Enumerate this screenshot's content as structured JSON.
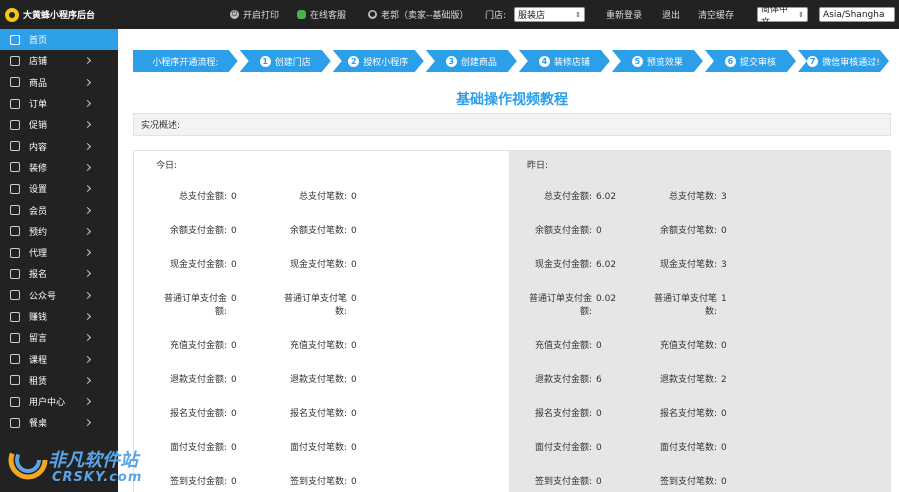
{
  "app": {
    "title": "大黄蜂小程序后台"
  },
  "topbar": {
    "print": "开启打印",
    "service": "在线客服",
    "user": "老郭（卖家--基础版）",
    "store_label": "门店:",
    "store_value": "服装店",
    "relogin": "重新登录",
    "logout": "退出",
    "clear_cache": "清空缓存",
    "language": "简体中文",
    "timezone": "Asia/Shangha"
  },
  "sidebar": {
    "items": [
      {
        "label": "首页",
        "active": true
      },
      {
        "label": "店铺"
      },
      {
        "label": "商品"
      },
      {
        "label": "订单"
      },
      {
        "label": "促销"
      },
      {
        "label": "内容"
      },
      {
        "label": "装修"
      },
      {
        "label": "设置"
      },
      {
        "label": "会员"
      },
      {
        "label": "预约"
      },
      {
        "label": "代理"
      },
      {
        "label": "报名"
      },
      {
        "label": "公众号"
      },
      {
        "label": "赚钱"
      },
      {
        "label": "留言"
      },
      {
        "label": "课程"
      },
      {
        "label": "租赁"
      },
      {
        "label": "用户中心"
      },
      {
        "label": "餐桌"
      }
    ]
  },
  "steps": {
    "intro": "小程序开通流程:",
    "items": [
      {
        "num": "1",
        "label": "创建门店"
      },
      {
        "num": "2",
        "label": "授权小程序"
      },
      {
        "num": "3",
        "label": "创建商品"
      },
      {
        "num": "4",
        "label": "装修店铺"
      },
      {
        "num": "5",
        "label": "预览效果"
      },
      {
        "num": "6",
        "label": "提交审核"
      },
      {
        "num": "7",
        "label": "微信审核通过!"
      }
    ]
  },
  "main": {
    "title": "基础操作视频教程",
    "overview": "实况概述:"
  },
  "stats": {
    "today": {
      "title": "今日:",
      "rows": [
        [
          {
            "label": "总支付金额:",
            "value": "0"
          },
          {
            "label": "总支付笔数:",
            "value": "0"
          }
        ],
        [
          {
            "label": "余额支付金额:",
            "value": "0"
          },
          {
            "label": "余额支付笔数:",
            "value": "0"
          }
        ],
        [
          {
            "label": "现金支付金额:",
            "value": "0"
          },
          {
            "label": "现金支付笔数:",
            "value": "0"
          }
        ],
        [
          {
            "label": "普通订单支付金额:",
            "value": "0"
          },
          {
            "label": "普通订单支付笔数:",
            "value": "0"
          }
        ],
        [
          {
            "label": "充值支付金额:",
            "value": "0"
          },
          {
            "label": "充值支付笔数:",
            "value": "0"
          }
        ],
        [
          {
            "label": "退款支付金额:",
            "value": "0"
          },
          {
            "label": "退款支付笔数:",
            "value": "0"
          }
        ],
        [
          {
            "label": "报名支付金额:",
            "value": "0"
          },
          {
            "label": "报名支付笔数:",
            "value": "0"
          }
        ],
        [
          {
            "label": "面付支付金额:",
            "value": "0"
          },
          {
            "label": "面付支付笔数:",
            "value": "0"
          }
        ],
        [
          {
            "label": "签到支付金额:",
            "value": "0"
          },
          {
            "label": "签到支付笔数:",
            "value": "0"
          }
        ]
      ]
    },
    "yesterday": {
      "title": "昨日:",
      "rows": [
        [
          {
            "label": "总支付金额:",
            "value": "6.02"
          },
          {
            "label": "总支付笔数:",
            "value": "3"
          }
        ],
        [
          {
            "label": "余额支付金额:",
            "value": "0"
          },
          {
            "label": "余额支付笔数:",
            "value": "0"
          }
        ],
        [
          {
            "label": "现金支付金额:",
            "value": "6.02"
          },
          {
            "label": "现金支付笔数:",
            "value": "3"
          }
        ],
        [
          {
            "label": "普通订单支付金额:",
            "value": "0.02"
          },
          {
            "label": "普通订单支付笔数:",
            "value": "1"
          }
        ],
        [
          {
            "label": "充值支付金额:",
            "value": "0"
          },
          {
            "label": "充值支付笔数:",
            "value": "0"
          }
        ],
        [
          {
            "label": "退款支付金额:",
            "value": "6"
          },
          {
            "label": "退款支付笔数:",
            "value": "2"
          }
        ],
        [
          {
            "label": "报名支付金额:",
            "value": "0"
          },
          {
            "label": "报名支付笔数:",
            "value": "0"
          }
        ],
        [
          {
            "label": "面付支付金额:",
            "value": "0"
          },
          {
            "label": "面付支付笔数:",
            "value": "0"
          }
        ],
        [
          {
            "label": "签到支付金额:",
            "value": "0"
          },
          {
            "label": "签到支付笔数:",
            "value": "0"
          }
        ]
      ]
    }
  },
  "watermark": {
    "text": "非凡软件站",
    "sub": "CRSKY.com"
  },
  "colors": {
    "accent": "#2d9fe8",
    "dark": "#222222"
  }
}
